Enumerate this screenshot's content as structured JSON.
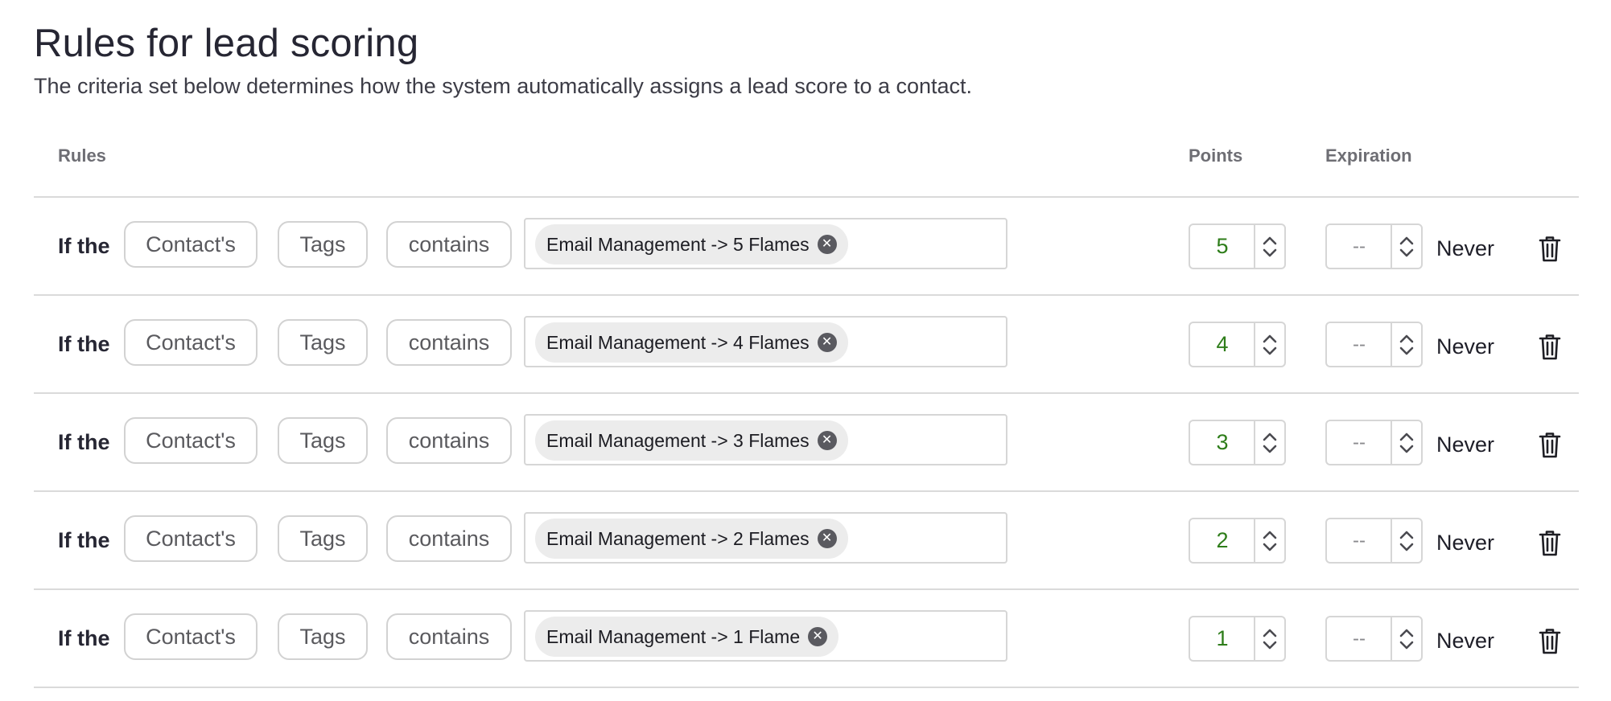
{
  "page": {
    "title": "Rules for lead scoring",
    "subtitle": "The criteria set below determines how the system automatically assigns a lead score to a contact."
  },
  "table": {
    "headers": {
      "rules": "Rules",
      "points": "Points",
      "expiration": "Expiration"
    },
    "rows": [
      {
        "prefix": "If the",
        "subject": "Contact's",
        "field": "Tags",
        "operator": "contains",
        "tag": "Email Management -> 5 Flames",
        "points": "5",
        "expiration_value": "--",
        "expiration_label": "Never"
      },
      {
        "prefix": "If the",
        "subject": "Contact's",
        "field": "Tags",
        "operator": "contains",
        "tag": "Email Management -> 4 Flames",
        "points": "4",
        "expiration_value": "--",
        "expiration_label": "Never"
      },
      {
        "prefix": "If the",
        "subject": "Contact's",
        "field": "Tags",
        "operator": "contains",
        "tag": "Email Management -> 3 Flames",
        "points": "3",
        "expiration_value": "--",
        "expiration_label": "Never"
      },
      {
        "prefix": "If the",
        "subject": "Contact's",
        "field": "Tags",
        "operator": "contains",
        "tag": "Email Management -> 2 Flames",
        "points": "2",
        "expiration_value": "--",
        "expiration_label": "Never"
      },
      {
        "prefix": "If the",
        "subject": "Contact's",
        "field": "Tags",
        "operator": "contains",
        "tag": "Email Management -> 1 Flame",
        "points": "1",
        "expiration_value": "--",
        "expiration_label": "Never"
      }
    ]
  },
  "icons": {
    "remove_tag": "close-circle-icon",
    "increment": "chevron-up-icon",
    "decrement": "chevron-down-icon",
    "delete_rule": "trash-icon"
  },
  "colors": {
    "points_text": "#2e7d1a",
    "border": "#d6d6d6",
    "chip_background": "#ececec"
  }
}
